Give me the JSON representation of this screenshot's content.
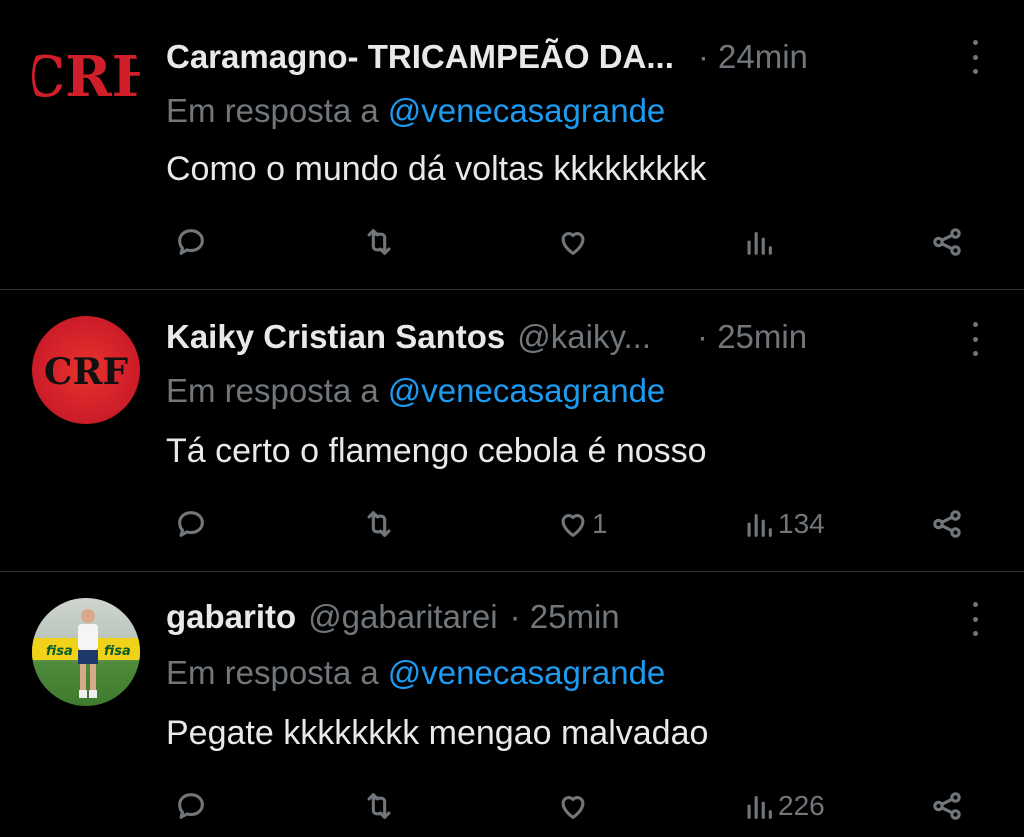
{
  "tweets": [
    {
      "name": "Caramagno- TRICAMPEÃO DA...",
      "handle": "",
      "time": "· 24min",
      "reply_prefix": "Em resposta a",
      "reply_to": "@venecasagrande",
      "text": "Como o mundo dá voltas kkkkkkkkk",
      "likes": "",
      "views": ""
    },
    {
      "name": "Kaiky Cristian Santos",
      "handle": "@kaiky...",
      "time": "· 25min",
      "reply_prefix": "Em resposta a",
      "reply_to": "@venecasagrande",
      "text": "Tá certo o flamengo cebola é nosso",
      "likes": "1",
      "views": "134"
    },
    {
      "name": "gabarito",
      "handle": "@gabaritarei",
      "time": "· 25min",
      "reply_prefix": "Em resposta a",
      "reply_to": "@venecasagrande",
      "text": "Pegate kkkkkkkk mengao malvadao",
      "likes": "",
      "views": "226"
    }
  ],
  "avatars": {
    "flamengo_logo_text": "CRF",
    "green_banner_text": "fisa"
  },
  "colors": {
    "background": "#000000",
    "text": "#e7e9ea",
    "muted": "#71767b",
    "link": "#1d9bf0",
    "flamengo_red": "#d01f2a",
    "divider": "#2f3336"
  },
  "icons": [
    "reply-icon",
    "retweet-icon",
    "like-icon",
    "views-icon",
    "share-icon",
    "more-icon"
  ]
}
